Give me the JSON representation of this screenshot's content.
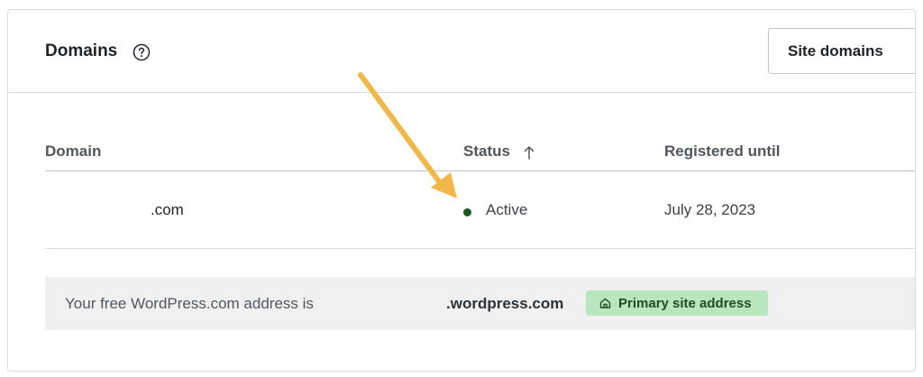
{
  "header": {
    "title": "Domains",
    "help_icon": "question-circle-icon",
    "site_domains_label": "Site domains"
  },
  "table": {
    "columns": [
      "Domain",
      "Status",
      "Registered until"
    ],
    "sort_icon": "arrow-up-icon",
    "rows": [
      {
        "domain": ".com",
        "status": "Active",
        "registered_until": "July 28, 2023"
      }
    ]
  },
  "free_address": {
    "text": "Your free WordPress.com address is",
    "address": ".wordpress.com",
    "badge_icon": "home-icon",
    "badge_label": "Primary site address"
  },
  "annotation": {
    "arrow_icon": "annotation-arrow-icon"
  },
  "colors": {
    "active_status": "#1a5a1e",
    "badge_bg": "#b8e6bf",
    "badge_text": "#1c4f22",
    "annotation_arrow": "#f0b849",
    "banner_bg": "#f0f0f1"
  }
}
